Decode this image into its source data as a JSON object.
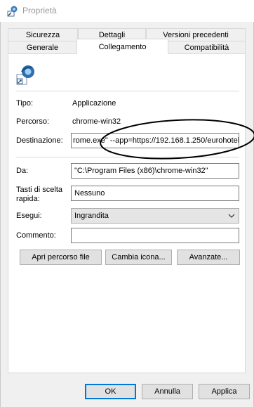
{
  "window": {
    "title": "Proprietà"
  },
  "tabs": {
    "row1": [
      "Sicurezza",
      "Dettagli",
      "Versioni precedenti"
    ],
    "row2": [
      "Generale",
      "Collegamento",
      "Compatibilità"
    ],
    "active": "Collegamento"
  },
  "shortcut": {
    "name": ""
  },
  "fields": {
    "tipo_label": "Tipo:",
    "tipo_value": "Applicazione",
    "percorso_label": "Percorso:",
    "percorso_value": "chrome-win32",
    "destinazione_label": "Destinazione:",
    "destinazione_value": "rome.exe\" --app=https://192.168.1.250/eurohotel",
    "da_label": "Da:",
    "da_value": "\"C:\\Program Files (x86)\\chrome-win32\"",
    "tasti_label": "Tasti di scelta rapida:",
    "tasti_value": "Nessuno",
    "esegui_label": "Esegui:",
    "esegui_value": "Ingrandita",
    "commento_label": "Commento:",
    "commento_value": ""
  },
  "buttons": {
    "apri": "Apri percorso file",
    "cambia": "Cambia icona...",
    "avanzate": "Avanzate...",
    "ok": "OK",
    "annulla": "Annulla",
    "applica": "Applica"
  },
  "icons": {
    "title": "properties-shortcut-icon",
    "shortcut": "chrome-shortcut-icon",
    "select": "chevron-down-icon"
  },
  "colors": {
    "accent": "#0078d7",
    "annotation": "#000000"
  }
}
